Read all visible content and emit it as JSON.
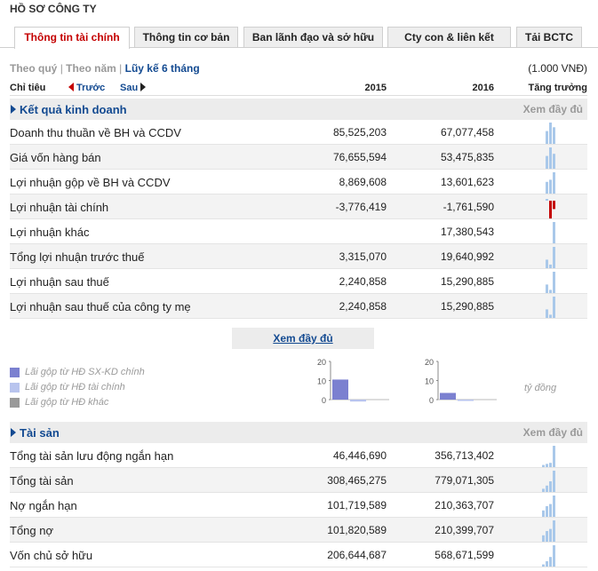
{
  "page_title": "HỒ SƠ CÔNG TY",
  "tabs": [
    {
      "label": "Thông tin tài chính",
      "active": true
    },
    {
      "label": "Thông tin cơ bản",
      "active": false
    },
    {
      "label": "Ban lãnh đạo và sở hữu",
      "active": false
    },
    {
      "label": "Cty con & liên kết",
      "active": false
    },
    {
      "label": "Tải BCTC",
      "active": false
    }
  ],
  "period": {
    "quarterly": "Theo quý",
    "yearly": "Theo năm",
    "cumulative": "Lũy kế 6 tháng",
    "separator": "|",
    "unit": "(1.000 VNĐ)"
  },
  "header": {
    "label": "Chỉ tiêu",
    "prev": "Trước",
    "next": "Sau",
    "year1": "2015",
    "year2": "2016",
    "growth": "Tăng trưởng"
  },
  "section_business": {
    "title": "Kết quả kinh doanh",
    "more": "Xem đầy đủ",
    "rows": [
      {
        "name": "Doanh thu thuần về BH và CCDV",
        "v2015": "85,525,203",
        "v2016": "67,077,458",
        "spark": [
          0,
          0,
          0.6,
          1.0,
          0.78
        ]
      },
      {
        "name": "Giá vốn hàng bán",
        "v2015": "76,655,594",
        "v2016": "53,475,835",
        "spark": [
          0,
          0,
          0.6,
          1.0,
          0.7
        ]
      },
      {
        "name": "Lợi nhuận gộp về BH và CCDV",
        "v2015": "8,869,608",
        "v2016": "13,601,623",
        "spark": [
          0,
          0,
          0.55,
          0.65,
          1.0
        ]
      },
      {
        "name": "Lợi nhuận tài chính",
        "v2015": "-3,776,419",
        "v2016": "-1,761,590",
        "spark": [
          0,
          0,
          0.1,
          -1.0,
          -0.47
        ]
      },
      {
        "name": "Lợi nhuận khác",
        "v2015": "",
        "v2016": "17,380,543",
        "spark": [
          0,
          0,
          0,
          0,
          1.0
        ]
      },
      {
        "name": "Tổng lợi nhuận trước thuế",
        "v2015": "3,315,070",
        "v2016": "19,640,992",
        "spark": [
          0,
          0,
          0.4,
          0.17,
          1.0
        ]
      },
      {
        "name": "Lợi nhuận sau thuế",
        "v2015": "2,240,858",
        "v2016": "15,290,885",
        "spark": [
          0,
          0,
          0.4,
          0.15,
          1.0
        ]
      },
      {
        "name": "Lợi nhuận sau thuế của công ty mẹ",
        "v2015": "2,240,858",
        "v2016": "15,290,885",
        "spark": [
          0,
          0,
          0.4,
          0.15,
          1.0
        ]
      }
    ]
  },
  "view_full_button": "Xem đầy đủ",
  "legend": [
    {
      "label": "Lãi gộp từ HĐ SX-KD chính",
      "color": "#7b80d0"
    },
    {
      "label": "Lãi gộp từ HĐ tài chính",
      "color": "#b8c4ee"
    },
    {
      "label": "Lãi gộp từ HĐ khác",
      "color": "#999999"
    }
  ],
  "chart_unit": "tỷ đồng",
  "chart_data": [
    {
      "type": "bar",
      "categories": [
        "Lãi gộp từ HĐ SX-KD chính",
        "Lãi gộp từ HĐ tài chính"
      ],
      "values": [
        10.5,
        -1.0
      ],
      "yticks": [
        "20",
        "10",
        "0"
      ],
      "ylim": [
        0,
        20
      ]
    },
    {
      "type": "bar",
      "categories": [
        "Lãi gộp từ HĐ SX-KD chính",
        "Lãi gộp từ HĐ tài chính"
      ],
      "values": [
        3.5,
        -0.5
      ],
      "yticks": [
        "20",
        "10",
        "0"
      ],
      "ylim": [
        0,
        20
      ]
    }
  ],
  "section_assets": {
    "title": "Tài sản",
    "more": "Xem đầy đủ",
    "rows": [
      {
        "name": "Tổng tài sản lưu động ngắn hạn",
        "v2015": "46,446,690",
        "v2016": "356,713,402",
        "spark": [
          0,
          0.1,
          0.15,
          0.2,
          1.0
        ]
      },
      {
        "name": "Tổng tài sản",
        "v2015": "308,465,275",
        "v2016": "779,071,305",
        "spark": [
          0,
          0.15,
          0.3,
          0.5,
          1.0
        ]
      },
      {
        "name": "Nợ ngắn hạn",
        "v2015": "101,719,589",
        "v2016": "210,363,707",
        "spark": [
          0,
          0.3,
          0.5,
          0.6,
          1.0
        ]
      },
      {
        "name": "Tổng nợ",
        "v2015": "101,820,589",
        "v2016": "210,399,707",
        "spark": [
          0,
          0.3,
          0.5,
          0.6,
          1.0
        ]
      },
      {
        "name": "Vốn chủ sở hữu",
        "v2015": "206,644,687",
        "v2016": "568,671,599",
        "spark": [
          0,
          0.1,
          0.25,
          0.45,
          1.0
        ]
      }
    ]
  },
  "colors": {
    "accent": "#134a91",
    "active_tab": "#c40000",
    "spark_pos": "#a9c8ea",
    "spark_neg": "#c40000"
  }
}
